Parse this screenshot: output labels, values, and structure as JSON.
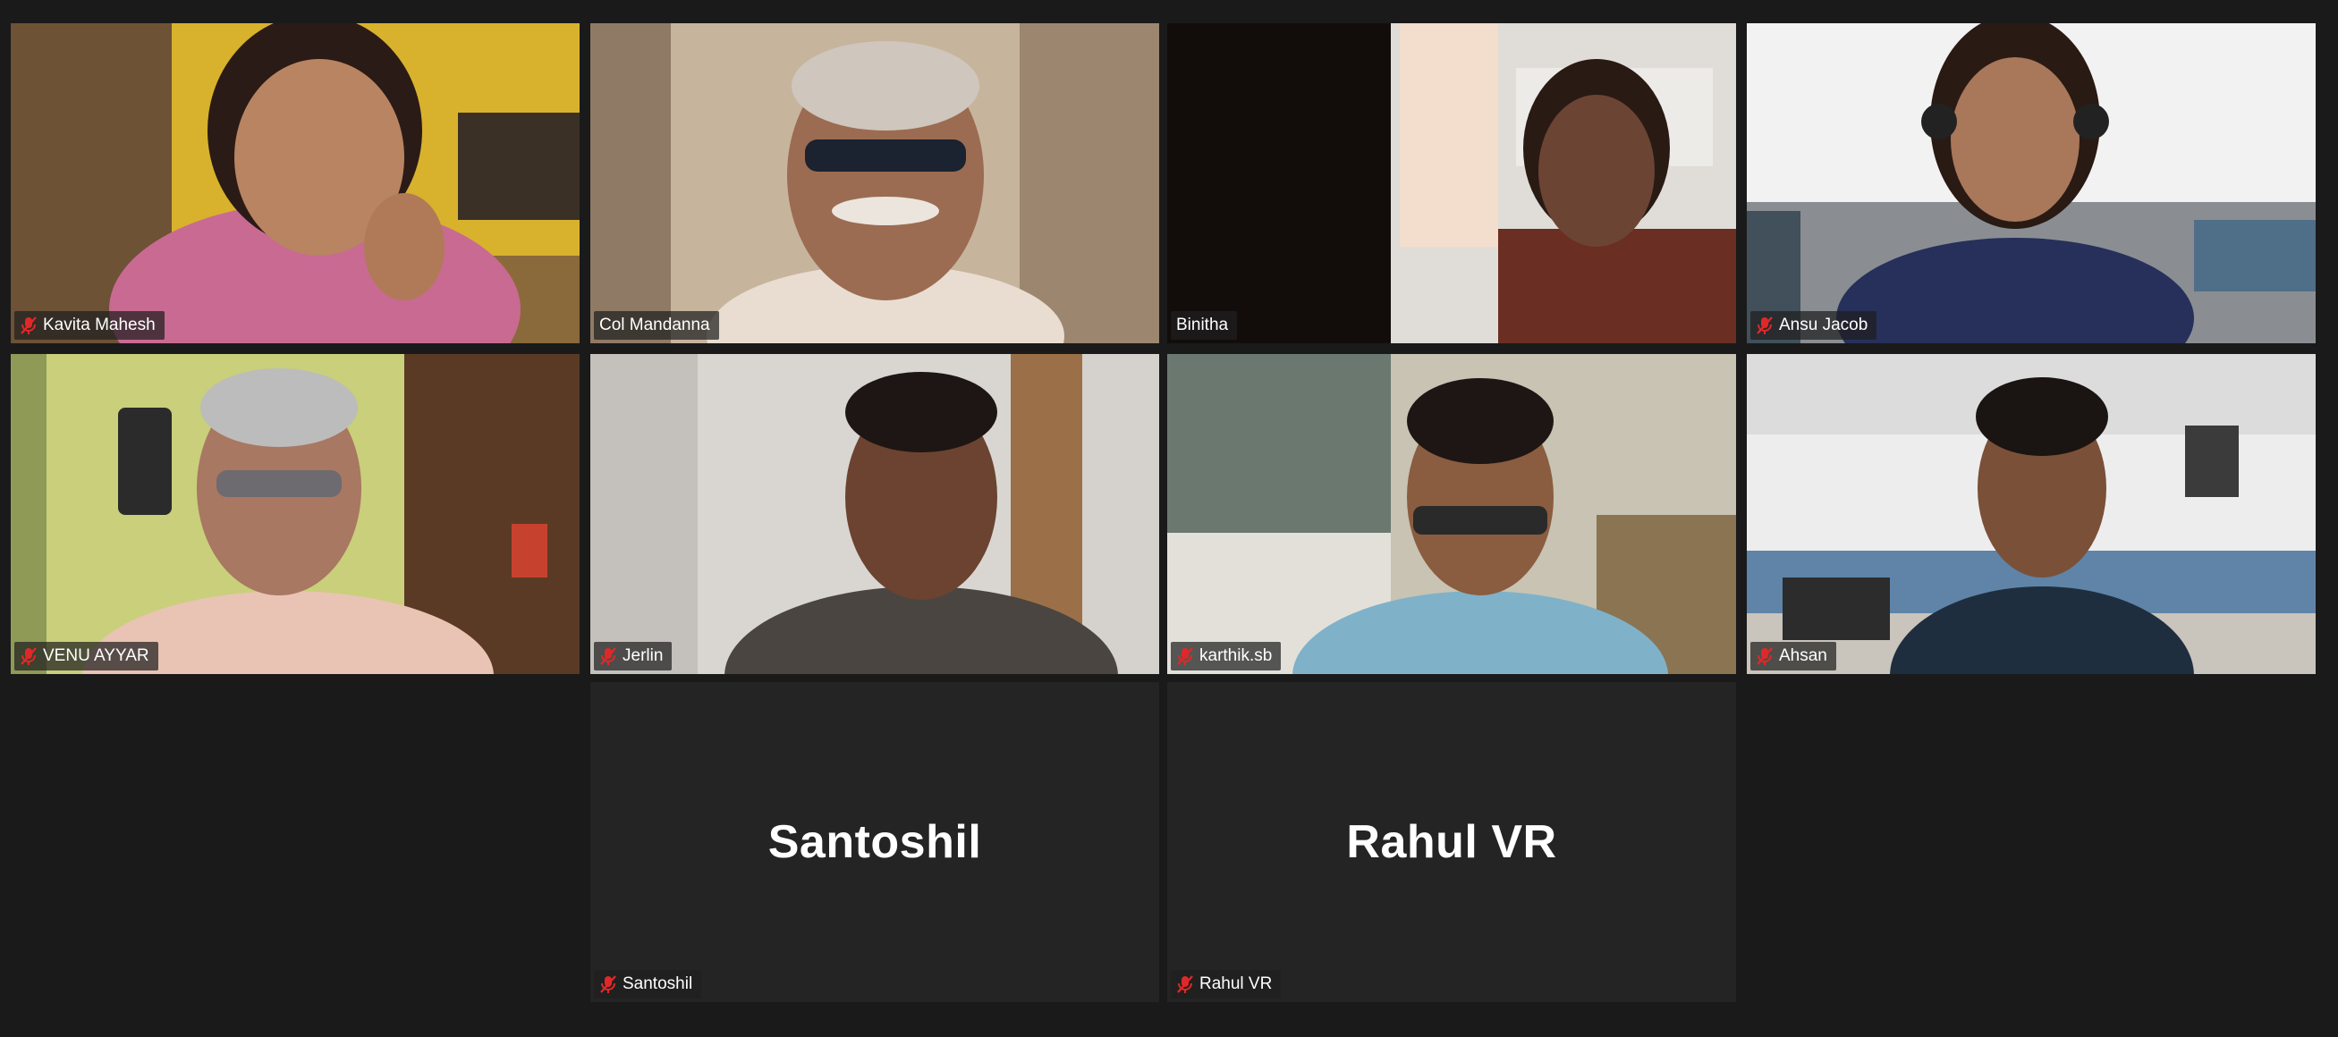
{
  "meeting": {
    "participants": [
      {
        "name": "Kavita Mahesh",
        "audio": "muted",
        "video": "on",
        "speaking": false
      },
      {
        "name": "Col Mandanna",
        "audio": "unmuted",
        "video": "on",
        "speaking": false
      },
      {
        "name": "Binitha",
        "audio": "unmuted",
        "video": "on",
        "speaking": true
      },
      {
        "name": "Ansu Jacob",
        "audio": "muted",
        "video": "on",
        "speaking": false
      },
      {
        "name": "VENU AYYAR",
        "audio": "muted",
        "video": "on",
        "speaking": false
      },
      {
        "name": "Jerlin",
        "audio": "muted",
        "video": "on",
        "speaking": false
      },
      {
        "name": "karthik.sb",
        "audio": "muted",
        "video": "on",
        "speaking": false
      },
      {
        "name": "Ahsan",
        "audio": "muted",
        "video": "on",
        "speaking": false
      },
      {
        "name": "Santoshil",
        "display_name": "Santoshil",
        "audio": "muted",
        "video": "off",
        "speaking": false
      },
      {
        "name": "Rahul VR",
        "display_name": "Rahul VR",
        "audio": "muted",
        "video": "off",
        "speaking": false
      }
    ]
  },
  "colors": {
    "active_speaker_border": "#c9e265",
    "muted_icon": "#e02828",
    "background": "#1a1a1a"
  },
  "icons": {
    "muted": "microphone-muted-icon"
  }
}
